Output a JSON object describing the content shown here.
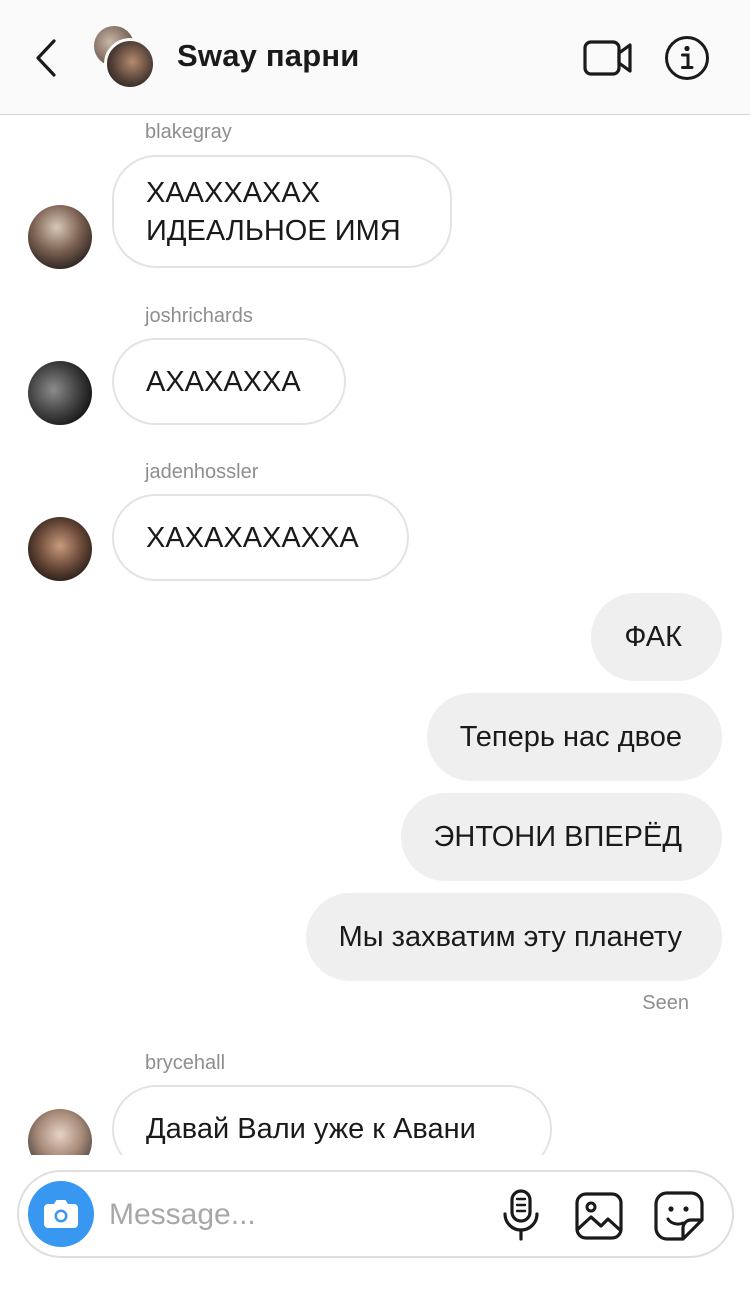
{
  "header": {
    "title": "Sway парни",
    "icons": {
      "back": "chevron-left-icon",
      "video": "video-camera-icon",
      "info": "info-icon"
    }
  },
  "messages": [
    {
      "sender": "blakegray",
      "lines": [
        "ХААХХАХАХ",
        "ИДЕАЛЬНОЕ ИМЯ"
      ],
      "direction": "incoming"
    },
    {
      "sender": "joshrichards",
      "text": "АХАХАХХА",
      "direction": "incoming"
    },
    {
      "sender": "jadenhossler",
      "text": "ХАХАХАХАХХА",
      "direction": "incoming"
    },
    {
      "text": "ФАК",
      "direction": "outgoing"
    },
    {
      "text": "Теперь нас двое",
      "direction": "outgoing"
    },
    {
      "text": "ЭНТОНИ ВПЕРЁД",
      "direction": "outgoing"
    },
    {
      "text": "Мы захватим эту планету",
      "direction": "outgoing"
    },
    {
      "sender": "brycehall",
      "text": "Давай Вали уже к Авани",
      "direction": "incoming"
    }
  ],
  "seen_label": "Seen",
  "composer": {
    "placeholder": "Message...",
    "icons": {
      "camera": "camera-icon",
      "mic": "microphone-icon",
      "gallery": "gallery-icon",
      "sticker": "sticker-icon"
    }
  },
  "colors": {
    "accent": "#3897f0",
    "outgoing_bubble": "#efefef",
    "incoming_border": "#e3e3e3",
    "secondary_text": "#8e8e8e",
    "header_bg": "#fafafa"
  }
}
